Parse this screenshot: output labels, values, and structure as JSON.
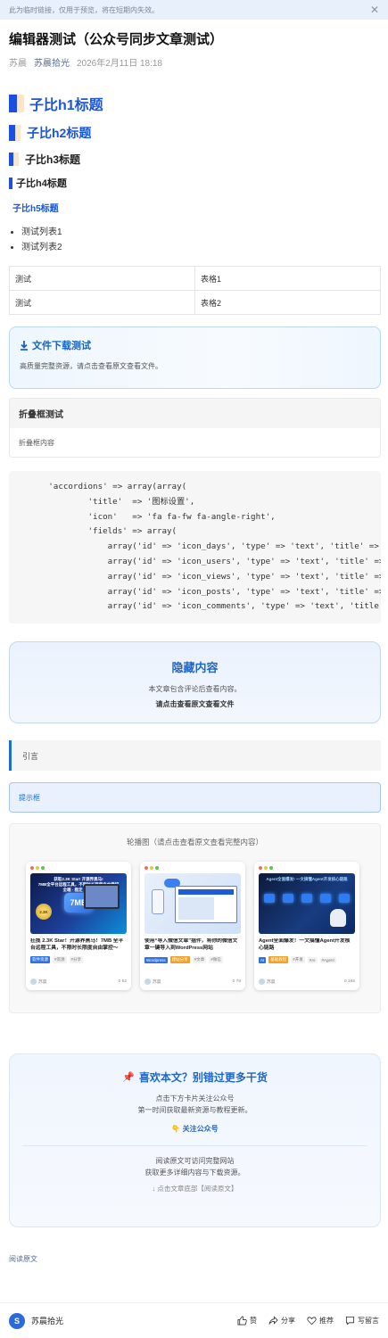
{
  "notice": {
    "text": "此为临时链接，仅用于预览，将在短期内失效。",
    "close": "✕"
  },
  "article": {
    "title": "编辑器测试（公众号同步文章测试）",
    "author": "苏晨",
    "account": "苏晨拾光",
    "date": "2026年2月11日 18:18"
  },
  "headings": {
    "h1": "子比h1标题",
    "h2": "子比h2标题",
    "h3": "子比h3标题",
    "h4": "子比h4标题",
    "h5": "子比h5标题"
  },
  "list": [
    "测试列表1",
    "测试列表2"
  ],
  "table": {
    "rows": [
      [
        "测试",
        "表格1"
      ],
      [
        "测试",
        "表格2"
      ]
    ]
  },
  "download": {
    "title": "文件下载测试",
    "desc": "高质量完整资源，请点击查看原文查看文件。"
  },
  "fold": {
    "title": "折叠框测试",
    "content": "折叠框内容"
  },
  "code": {
    "lines": [
      "        'accordions' => array(array(",
      "                'title'  => '图标设置',",
      "                'icon'   => 'fa fa-fw fa-angle-right',",
      "                'fields' => array(",
      "                    array('id' => 'icon_days', 'type' => 'text', 'title' => '天数图标'),",
      "                    array('id' => 'icon_users', 'type' => 'text', 'title' => '用户图标'),",
      "                    array('id' => 'icon_views', 'type' => 'text', 'title' => '浏览图标'),",
      "                    array('id' => 'icon_posts', 'type' => 'text', 'title' => '文章图标'),",
      "                    array('id' => 'icon_comments', 'type' => 'text', 'title' => '评论图标'),"
    ]
  },
  "hidden": {
    "title": "隐藏内容",
    "desc": "本文章包含评论后查看内容。",
    "link": "请点击查看原文查看文件"
  },
  "quote": "引言",
  "tip": "提示框",
  "carousel": {
    "caption": "轮播图（请点击查看原文查看完整内容）",
    "cards": [
      {
        "thumb_text": "获取2.3K Star! 开源界黑马!\n7MB全平台远程工具，不限时长限度自由掌控\n全端 · 稳定 · 不限",
        "title": "狂揽 2.3K Star！开源界黑马！7MB 全平台远程工具，不限时长限度自由掌控～",
        "tags": [
          "软件资源",
          "#资源",
          "#分享"
        ],
        "author": "苏晨",
        "stats": "0  62"
      },
      {
        "thumb_text": "",
        "title": "使用“导入微信文章”插件，将你的微信文章一键导入到WordPress网站",
        "tags": [
          "Wordpress",
          "建站分享",
          "#文章",
          "#微信"
        ],
        "author": "苏晨",
        "stats": "0  78"
      },
      {
        "thumb_text": "Agent全面爆发! 一文搞懂Agent开发核心链路",
        "title": "Agent全面爆发！一文搞懂Agent开发核心链路",
        "tags": [
          "AI",
          "基础教程",
          "#开发",
          "#AI",
          "#Agent"
        ],
        "author": "苏晨",
        "stats": "0  165"
      }
    ]
  },
  "promo": {
    "title": "喜欢本文？别错过更多干货",
    "line1": "点击下方卡片关注公众号",
    "line2": "第一时间获取最新资源与教程更新。",
    "follow": "👇 关注公众号",
    "read1": "阅读原文可访问完整网站",
    "read2": "获取更多详细内容与下载资源。",
    "hint": "↓ 点击文章底部【阅读原文】"
  },
  "read_original": "阅读原文",
  "bottom": {
    "avatar_letter": "S",
    "name": "苏晨拾光",
    "like": "赞",
    "share": "分享",
    "recommend": "推荐",
    "comment": "写留言"
  },
  "colors": {
    "accent": "#1f66c9",
    "heading_bar": "#1f4fe0",
    "heading_glow": "#fde6c8",
    "notice_bg": "#e7f0fb"
  }
}
